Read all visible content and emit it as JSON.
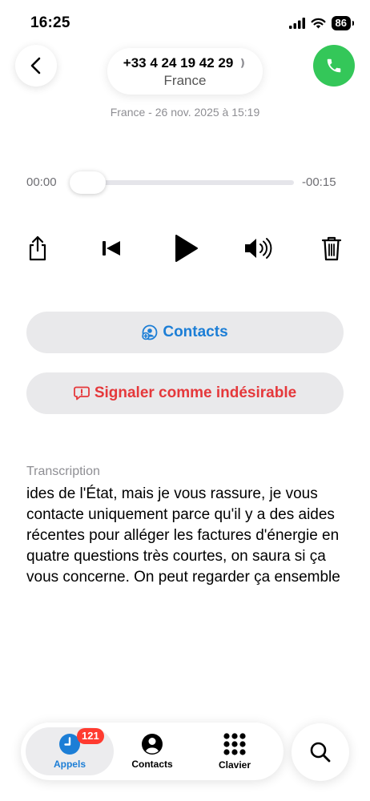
{
  "status_bar": {
    "time": "16:25",
    "battery": "86"
  },
  "header": {
    "phone_number": "+33 4 24 19 42 29",
    "chevron": "❫",
    "country": "France",
    "meta": "France - 26 nov. 2025 à 15:19"
  },
  "player": {
    "elapsed": "00:00",
    "remaining": "-00:15",
    "progress": 0
  },
  "actions": {
    "contacts_label": "Contacts",
    "spam_label": "Signaler comme indésirable"
  },
  "transcription": {
    "label": "Transcription",
    "text": "ides de l'État, mais je vous rassure, je vous contacte uniquement parce qu'il y a des aides récentes pour alléger les factures d'énergie en quatre questions très courtes, on saura si ça vous concerne. On peut regarder ça ensemble"
  },
  "tabbar": {
    "tabs": [
      {
        "label": "Appels",
        "icon": "clock-icon",
        "active": true
      },
      {
        "label": "Contacts",
        "icon": "person-icon",
        "active": false
      },
      {
        "label": "Clavier",
        "icon": "keypad-icon",
        "active": false
      }
    ],
    "badge": "121"
  },
  "colors": {
    "accent": "#1c7ed6",
    "danger": "#e5383b",
    "call_green": "#34c759",
    "badge_red": "#ff3b30"
  }
}
